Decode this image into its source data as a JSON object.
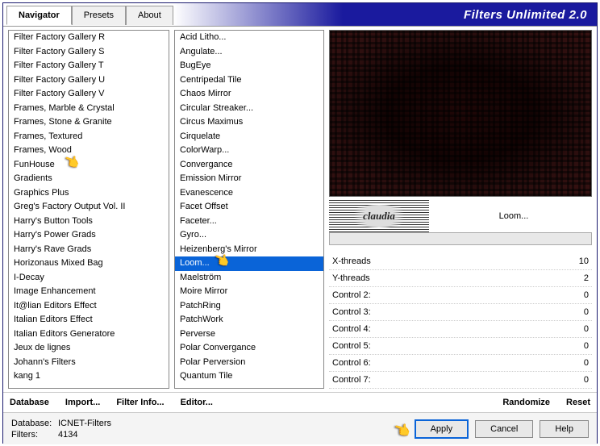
{
  "app_title": "Filters Unlimited 2.0",
  "tabs": [
    "Navigator",
    "Presets",
    "About"
  ],
  "active_tab": 0,
  "categories": [
    "Filter Factory Gallery R",
    "Filter Factory Gallery S",
    "Filter Factory Gallery T",
    "Filter Factory Gallery U",
    "Filter Factory Gallery V",
    "Frames, Marble & Crystal",
    "Frames, Stone & Granite",
    "Frames, Textured",
    "Frames, Wood",
    "FunHouse",
    "Gradients",
    "Graphics Plus",
    "Greg's Factory Output Vol. II",
    "Harry's Button Tools",
    "Harry's Power Grads",
    "Harry's Rave Grads",
    "Horizonaus Mixed Bag",
    "I-Decay",
    "Image Enhancement",
    "It@lian Editors Effect",
    "Italian Editors Effect",
    "Italian Editors Generatore",
    "Jeux de lignes",
    "Johann's Filters",
    "kang 1"
  ],
  "highlighted_category_index": 9,
  "filters": [
    "Acid Litho...",
    "Angulate...",
    "BugEye",
    "Centripedal Tile",
    "Chaos Mirror",
    "Circular Streaker...",
    "Circus Maximus",
    "Cirquelate",
    "ColorWarp...",
    "Convergance",
    "Emission Mirror",
    "Evanescence",
    "Facet Offset",
    "Faceter...",
    "Gyro...",
    "Heizenberg's Mirror",
    "Loom...",
    "Maelström",
    "Moire Mirror",
    "PatchRing",
    "PatchWork",
    "Perverse",
    "Polar Convergance",
    "Polar Perversion",
    "Quantum Tile"
  ],
  "selected_filter_index": 16,
  "logo_text": "claudia",
  "current_filter_label": "Loom...",
  "controls": [
    {
      "label": "X-threads",
      "value": 10
    },
    {
      "label": "Y-threads",
      "value": 2
    },
    {
      "label": "Control 2:",
      "value": 0
    },
    {
      "label": "Control 3:",
      "value": 0
    },
    {
      "label": "Control 4:",
      "value": 0
    },
    {
      "label": "Control 5:",
      "value": 0
    },
    {
      "label": "Control 6:",
      "value": 0
    },
    {
      "label": "Control 7:",
      "value": 0
    }
  ],
  "bottom_bar": {
    "database": "Database",
    "import": "Import...",
    "filter_info": "Filter Info...",
    "editor": "Editor...",
    "randomize": "Randomize",
    "reset": "Reset"
  },
  "footer": {
    "db_label": "Database:",
    "db_value": "ICNET-Filters",
    "filters_label": "Filters:",
    "filters_value": "4134",
    "apply": "Apply",
    "cancel": "Cancel",
    "help": "Help"
  }
}
